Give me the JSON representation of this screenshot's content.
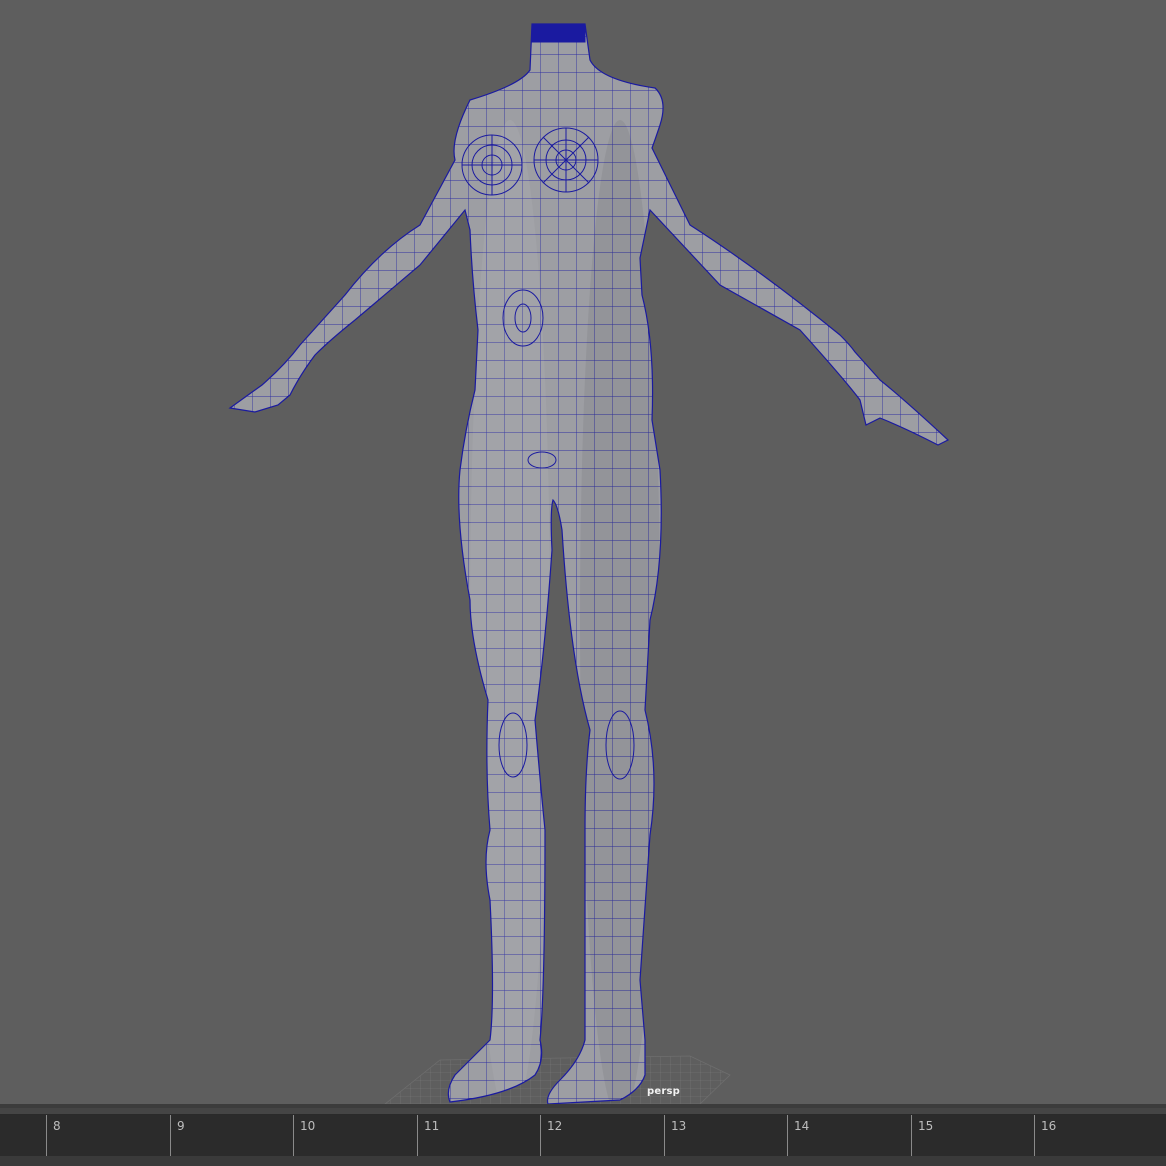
{
  "viewport": {
    "camera_label": "persp",
    "background_color": "#5e5e5e",
    "mesh_fill_color": "#9d9ea3",
    "wireframe_color": "#1a1aa0"
  },
  "timeline": {
    "frames": [
      "8",
      "9",
      "10",
      "11",
      "12",
      "13",
      "14",
      "15",
      "16"
    ]
  }
}
